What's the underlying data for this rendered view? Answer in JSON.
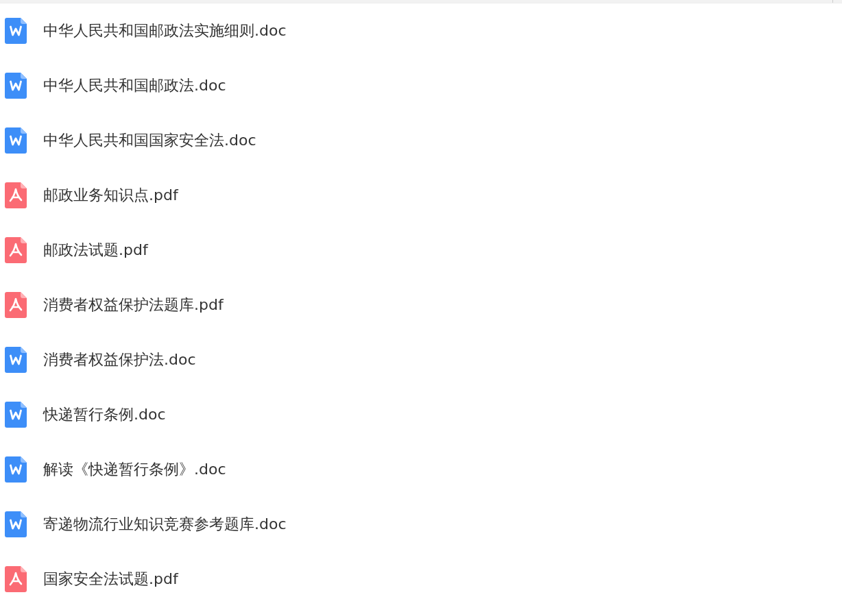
{
  "files": [
    {
      "name": "中华人民共和国邮政法实施细则.doc",
      "kind": "word"
    },
    {
      "name": "中华人民共和国邮政法.doc",
      "kind": "word"
    },
    {
      "name": "中华人民共和国国家安全法.doc",
      "kind": "word"
    },
    {
      "name": "邮政业务知识点.pdf",
      "kind": "pdf"
    },
    {
      "name": "邮政法试题.pdf",
      "kind": "pdf"
    },
    {
      "name": "消费者权益保护法题库.pdf",
      "kind": "pdf"
    },
    {
      "name": "消费者权益保护法.doc",
      "kind": "word"
    },
    {
      "name": "快递暂行条例.doc",
      "kind": "word"
    },
    {
      "name": "解读《快递暂行条例》.doc",
      "kind": "word"
    },
    {
      "name": "寄递物流行业知识竞赛参考题库.doc",
      "kind": "word"
    },
    {
      "name": "国家安全法试题.pdf",
      "kind": "pdf"
    }
  ]
}
